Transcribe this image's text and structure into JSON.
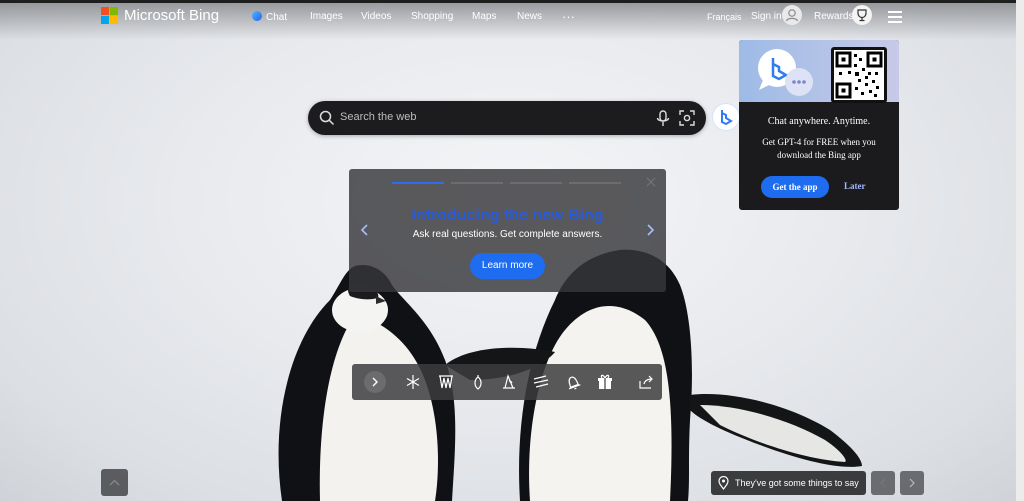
{
  "brand": {
    "name": "Microsoft Bing"
  },
  "nav": {
    "items": [
      {
        "label": "Chat"
      },
      {
        "label": "Images"
      },
      {
        "label": "Videos"
      },
      {
        "label": "Shopping"
      },
      {
        "label": "Maps"
      },
      {
        "label": "News"
      },
      {
        "label": "···"
      }
    ]
  },
  "header_right": {
    "language": "Français",
    "signin": "Sign in",
    "rewards": "Rewards"
  },
  "search": {
    "placeholder": "Search the web"
  },
  "promo": {
    "title": "Chat anywhere. Anytime.",
    "subtitle": "Get GPT-4 for FREE when you download the Bing app",
    "primary": "Get the app",
    "secondary": "Later"
  },
  "carousel": {
    "title": "Introducing the new Bing",
    "subtitle": "Ask real questions. Get complete answers.",
    "button": "Learn more",
    "slides_total": 4,
    "active_slide": 1
  },
  "bottom": {
    "tip": "They've got some things to say"
  },
  "toolbar": {
    "icons": [
      "chevron-right-icon",
      "snowflake-icon",
      "forest-icon",
      "ornament-icon",
      "hat-icon",
      "wind-icon",
      "bell-icon",
      "gift-icon",
      "share-icon"
    ]
  },
  "colors": {
    "accent": "#1e6cf0",
    "title_blue": "#2a5bd7",
    "panel": "#1b1b1d"
  }
}
